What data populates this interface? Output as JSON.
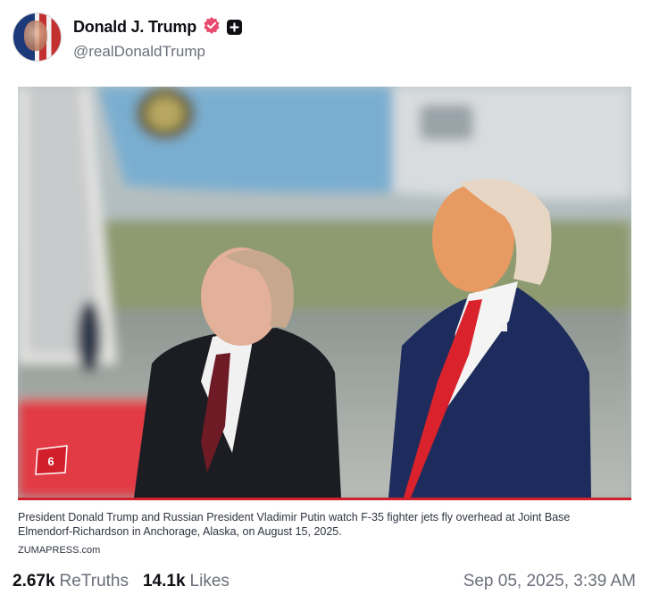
{
  "author": {
    "display_name": "Donald J. Trump",
    "handle": "@realDonaldTrump",
    "verified_icon": "verified-badge-icon",
    "plus_icon": "plus-badge-icon"
  },
  "media": {
    "corner_badge": "6",
    "caption": "President Donald Trump and Russian President Vladimir Putin watch F-35 fighter jets fly overhead at Joint Base Elmendorf-Richardson in Anchorage, Alaska, on August 15, 2025.",
    "credit": "ZUMAPRESS.com"
  },
  "stats": {
    "retruths_count": "2.67k",
    "retruths_label": "ReTruths",
    "likes_count": "14.1k",
    "likes_label": "Likes"
  },
  "timestamp": "Sep 05, 2025, 3:39 AM",
  "colors": {
    "verified": "#e94b6f",
    "accent_rule": "#d11f2b",
    "muted_text": "#6b6f7a"
  }
}
